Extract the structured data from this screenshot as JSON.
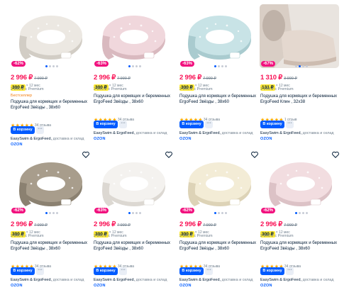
{
  "colors": {
    "accent": "#005bff",
    "price": "#f91155",
    "discount_badge": "#f1117e",
    "installment_badge": "#fee933",
    "stars": "#ffa800",
    "bestseller": "#f27b0c"
  },
  "products": [
    {
      "discount": "-62%",
      "price": "2 996 ₽",
      "old_price": "7 990 ₽",
      "installment_price": "300 ₽",
      "installment_term": "× 12 мес",
      "premium_price": "2 840 ₽ с Premium",
      "badge": "Бестселлер",
      "title": "Подушка для кормящих и беременных ErgoFeed Звёзды , 38х60",
      "stars": "★★★★★",
      "rating_value": 5,
      "reviews": "34 отзыва",
      "cart_label": "В корзину",
      "more_label": "···",
      "seller": "EasySwim & ErgoFeed",
      "delivery": "доставка и склад",
      "ozon": "OZON",
      "image_colors": [
        "#ece8e2",
        "#d2cdc5"
      ],
      "active_image": 0,
      "image_count": 4,
      "wishlist_icon": "heart-icon"
    },
    {
      "discount": "-63%",
      "price": "2 996 ₽",
      "old_price": "7 990 ₽",
      "installment_price": "300 ₽",
      "installment_term": "× 12 мес",
      "premium_price": "2 840 ₽ с Premium",
      "title": "Подушка для кормящих и беременных ErgoFeed Звёзды , 38х60",
      "stars": "★★★★★",
      "rating_value": 5,
      "reviews": "34 отзыва",
      "cart_label": "В корзину",
      "more_label": "···",
      "seller": "EasySwim & ErgoFeed",
      "delivery": "доставка и склад",
      "ozon": "OZON",
      "image_colors": [
        "#f0d7dc",
        "#d9b9bf"
      ],
      "active_image": 0,
      "image_count": 4,
      "wishlist_icon": "heart-icon"
    },
    {
      "discount": "-63%",
      "price": "2 996 ₽",
      "old_price": "7 990 ₽",
      "installment_price": "300 ₽",
      "installment_term": "× 12 мес",
      "premium_price": "2 840 ₽ с Premium",
      "title": "Подушка для кормящих и беременных ErgoFeed Звёзды , 38х60",
      "stars": "★★★★★",
      "rating_value": 5,
      "reviews": "34 отзыва",
      "cart_label": "В корзину",
      "more_label": "···",
      "seller": "EasySwim & ErgoFeed",
      "delivery": "доставка и склад",
      "ozon": "OZON",
      "image_colors": [
        "#c8e3e6",
        "#a9cbcf"
      ],
      "active_image": 0,
      "image_count": 4,
      "wishlist_icon": "heart-icon"
    },
    {
      "discount": "-67%",
      "price": "1 310 ₽",
      "old_price": "3 990 ₽",
      "installment_price": "131 ₽",
      "installment_term": "× 12 мес",
      "premium_price": "1 240 ₽ с Premium",
      "title": "Подушка для кормящих и беременных ErgoFeed Клин , 32х38",
      "stars": "★★★★★",
      "rating_value": 5,
      "reviews": "1 отзыв",
      "cart_label": "В корзину",
      "more_label": "···",
      "seller": "EasySwim & ErgoFeed",
      "delivery": "доставка и склад",
      "ozon": "OZON",
      "image_colors": [
        "#e4d8cf",
        "#cdbcb0"
      ],
      "active_image": 1,
      "image_count": 4,
      "wishlist_icon": "heart-icon"
    },
    {
      "discount": "-62%",
      "price": "2 996 ₽",
      "old_price": "7 990 ₽",
      "installment_price": "300 ₽",
      "installment_term": "× 12 мес",
      "premium_price": "2 840 ₽ с Premium",
      "title": "Подушка для кормящих и беременных ErgoFeed Звёзды , 38х60",
      "stars": "★★★★★",
      "rating_value": 5,
      "reviews": "34 отзыва",
      "cart_label": "В корзину",
      "more_label": "···",
      "seller": "EasySwim & ErgoFeed",
      "delivery": "доставка и склад",
      "ozon": "OZON",
      "image_colors": [
        "#a89d8c",
        "#8b8171"
      ],
      "active_image": 0,
      "image_count": 4,
      "wishlist_icon": "heart-icon"
    },
    {
      "discount": "-63%",
      "price": "2 996 ₽",
      "old_price": "7 990 ₽",
      "installment_price": "300 ₽",
      "installment_term": "× 12 мес",
      "premium_price": "2 840 ₽ с Premium",
      "title": "Подушка для кормящих и беременных ErgoFeed Звёзды , 38х60",
      "stars": "★★★★★",
      "rating_value": 5,
      "reviews": "34 отзыва",
      "cart_label": "В корзину",
      "more_label": "···",
      "seller": "EasySwim & ErgoFeed",
      "delivery": "доставка и склад",
      "ozon": "OZON",
      "image_colors": [
        "#f4f2ef",
        "#dcd8d2"
      ],
      "active_image": 0,
      "image_count": 4,
      "wishlist_icon": "heart-icon"
    },
    {
      "discount": "-62%",
      "price": "2 996 ₽",
      "old_price": "7 990 ₽",
      "installment_price": "300 ₽",
      "installment_term": "× 12 мес",
      "premium_price": "2 840 ₽ с Premium",
      "title": "Подушка для кормящих и беременных ErgoFeed Звёзды , 38х60",
      "stars": "★★★★★",
      "rating_value": 5,
      "reviews": "34 отзыва",
      "cart_label": "В корзину",
      "more_label": "···",
      "seller": "EasySwim & ErgoFeed",
      "delivery": "доставка и склад",
      "ozon": "OZON",
      "image_colors": [
        "#f3ecd6",
        "#ddd3b7"
      ],
      "active_image": 0,
      "image_count": 4,
      "wishlist_icon": "heart-icon"
    },
    {
      "discount": "-62%",
      "price": "2 996 ₽",
      "old_price": "7 990 ₽",
      "installment_price": "300 ₽",
      "installment_term": "× 12 мес",
      "premium_price": "2 840 ₽ с Premium",
      "title": "Подушка для кормящих и беременных ErgoFeed Звёзды , 38х60",
      "stars": "★★★★★",
      "rating_value": 5,
      "reviews": "34 отзыва",
      "cart_label": "В корзину",
      "more_label": "···",
      "seller": "EasySwim & ErgoFeed",
      "delivery": "доставка и склад",
      "ozon": "OZON",
      "image_colors": [
        "#f2dde0",
        "#dcc2c6"
      ],
      "active_image": 0,
      "image_count": 4,
      "wishlist_icon": "heart-icon"
    }
  ]
}
